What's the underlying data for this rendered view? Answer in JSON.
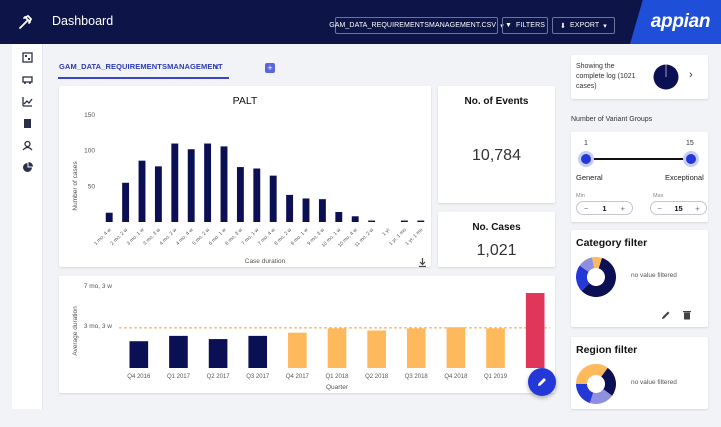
{
  "header": {
    "title": "Dashboard",
    "file_label": "GAM_DATA_REQUIREMENTSMANAGEMENT.CSV",
    "filters_label": "FILTERS",
    "export_label": "EXPORT",
    "brand": "appian"
  },
  "tab": {
    "label": "GAM_DATA_REQUIREMENTSMANAGEMENT",
    "close": "×",
    "add": "+"
  },
  "palt_card": {
    "title": "PALT",
    "ylabel": "Number of cases",
    "xlabel": "Case duration"
  },
  "events_card": {
    "title": "No. of Events",
    "value": "10,784"
  },
  "cases_card": {
    "title": "No. Cases",
    "value": "1,021"
  },
  "quarter_card": {
    "ylabel": "Average duration",
    "xlabel": "Quarter",
    "ytick_top": "7 mo, 3 w",
    "ytick_mid": "3 mo, 3 w"
  },
  "log_card": {
    "text1": "Showing the",
    "text2": "complete log (1021",
    "text3": "cases)"
  },
  "variants": {
    "label": "Number of Variant Groups",
    "min_value": "1",
    "max_value": "15",
    "left_label": "General",
    "right_label": "Exceptional",
    "min_label": "Min",
    "max_label": "Max",
    "min_field": "1",
    "max_field": "15",
    "minus": "−",
    "plus": "+"
  },
  "category_filter": {
    "title": "Category filter",
    "status": "no value filtered"
  },
  "region_filter": {
    "title": "Region filter",
    "status": "no value filtered"
  },
  "colors": {
    "navy": "#0b0f54",
    "orange": "#fdb95c",
    "red": "#e0365a",
    "accent": "#2438d8"
  },
  "chart_data": [
    {
      "type": "bar",
      "title": "PALT",
      "xlabel": "Case duration",
      "ylabel": "Number of cases",
      "ylim": [
        0,
        150
      ],
      "yticks": [
        50,
        100,
        150
      ],
      "categories": [
        "1 mo, 4 w",
        "2 mo, 2 w",
        "3 mo, 1 w",
        "3 mo, 3 w",
        "4 mo, 2 w",
        "4 mo, 4 w",
        "5 mo, 2 w",
        "6 mo, 1 w",
        "6 mo, 3 w",
        "7 mo, 1 w",
        "7 mo, 4 w",
        "8 mo, 2 w",
        "9 mo, 1 w",
        "9 mo, 3 w",
        "10 mo, 1 w",
        "10 mo, 4 w",
        "11 mo, 2 w",
        "1 yr",
        "1 yr, 1 mo",
        "1 yr, 1 mo"
      ],
      "values": [
        13,
        55,
        86,
        78,
        110,
        102,
        110,
        106,
        77,
        75,
        65,
        38,
        33,
        32,
        14,
        8,
        2,
        0,
        2,
        2
      ]
    },
    {
      "type": "bar",
      "xlabel": "Quarter",
      "ylabel": "Average duration",
      "categories": [
        "Q4 2016",
        "Q1 2017",
        "Q2 2017",
        "Q3 2017",
        "Q4 2017",
        "Q1 2018",
        "Q2 2018",
        "Q3 2018",
        "Q4 2018",
        "Q1 2019",
        ""
      ],
      "values_months": [
        2.5,
        3.0,
        2.7,
        3.0,
        3.3,
        3.7,
        3.5,
        3.7,
        3.8,
        3.7,
        7.0
      ],
      "bar_colors": [
        "navy",
        "navy",
        "navy",
        "navy",
        "orange",
        "orange",
        "orange",
        "orange",
        "orange",
        "orange",
        "red"
      ],
      "reference_line_months": 3.75,
      "yticks": [
        "3 mo, 3 w",
        "7 mo, 3 w"
      ]
    },
    {
      "type": "pie",
      "title": "Category filter",
      "values": [
        58,
        22,
        12,
        8
      ],
      "colors": [
        "#0b0f54",
        "#2438d8",
        "#8f8fe0",
        "#fdb95c"
      ]
    },
    {
      "type": "pie",
      "title": "Region filter",
      "values": [
        35,
        25,
        20,
        20
      ],
      "colors": [
        "#fdb95c",
        "#0b0f54",
        "#8f8fe0",
        "#2438d8"
      ]
    }
  ]
}
